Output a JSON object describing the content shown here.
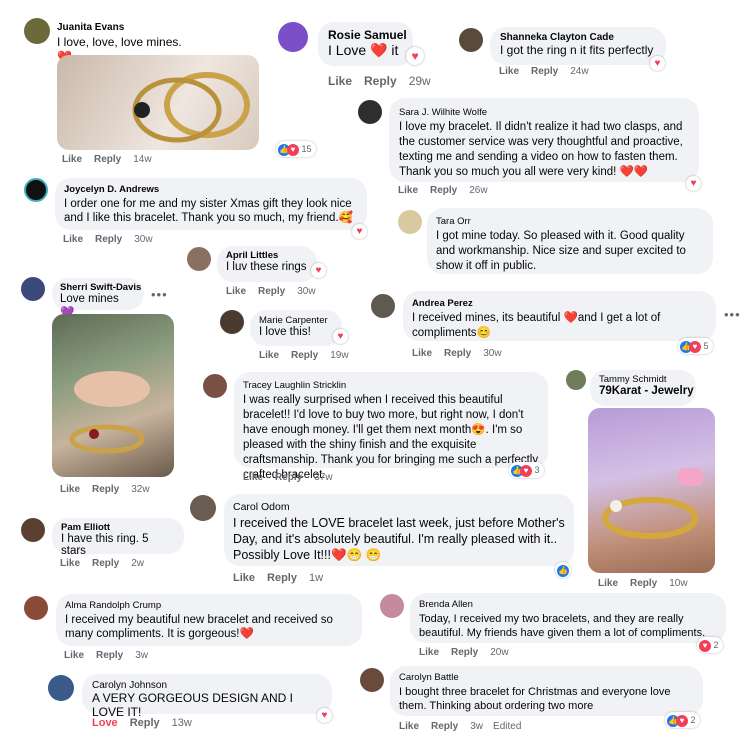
{
  "comments": [
    {
      "name": "Juanita Evans",
      "text": "I love, love, love mines.",
      "emoji": "❤️",
      "like": "Like",
      "reply": "Reply",
      "time": "14w",
      "reaction_count": "15"
    },
    {
      "name": "Rosie Samuel",
      "text_a": "I Love",
      "text_b": "it",
      "emoji": "❤️",
      "like": "Like",
      "reply": "Reply",
      "time": "29w"
    },
    {
      "name": "Shanneka Clayton Cade",
      "text": "I got the ring n it fits perfectly",
      "like": "Like",
      "reply": "Reply",
      "time": "24w"
    },
    {
      "name": "Sara J. Wilhite Wolfe",
      "text": "I love my bracelet. Il didn't realize it had two clasps, and the customer service was very thoughtful and proactive, texting me and sending a video on how to fasten them. Thank you so much you all were very kind!",
      "emoji": "❤️❤️",
      "like": "Like",
      "reply": "Reply",
      "time": "26w"
    },
    {
      "name": "Joycelyn D. Andrews",
      "text": "I order one for me and my sister Xmas gift they look nice and I like this bracelet. Thank you so much, my friend.",
      "emoji": "🥰",
      "like": "Like",
      "reply": "Reply",
      "time": "30w"
    },
    {
      "name": "Tara Orr",
      "text": "I got mine today. So pleased with it. Good quality and workmanship. Nice size and super excited to show it off in public."
    },
    {
      "name": "April Littles",
      "text": "I luv these rings",
      "like": "Like",
      "reply": "Reply",
      "time": "30w"
    },
    {
      "name": "Sherri Swift-Davis",
      "text": "Love mines",
      "emoji": "💜",
      "like": "Like",
      "reply": "Reply",
      "time": "32w"
    },
    {
      "name": "Andrea Perez",
      "text_a": "I received mines, its beautiful",
      "text_b": "and I get a lot of compliments",
      "emoji": "❤️",
      "emoji2": "😊",
      "like": "Like",
      "reply": "Reply",
      "time": "30w",
      "reaction_count": "5"
    },
    {
      "name": "Marie Carpenter",
      "text": "I love this!",
      "like": "Like",
      "reply": "Reply",
      "time": "19w"
    },
    {
      "name": "Tracey Laughlin Stricklin",
      "text": "I was really surprised when I received this beautiful bracelet!! I'd love to buy two more, but right now, I don't have enough money. I'll get them next month",
      "emoji": "😍",
      "text_b": ". I'm so pleased with the shiny finish and the exquisite craftsmanship. Thank you for bringing me such a perfectly crafted bracelet.",
      "like": "Like",
      "reply": "Reply",
      "time": "37w",
      "reaction_count": "3"
    },
    {
      "name": "Tammy Schmidt",
      "subtitle": "79Karat - Jewelry",
      "like": "Like",
      "reply": "Reply",
      "time": "10w"
    },
    {
      "name": "Carol Odom",
      "text": "I received the LOVE bracelet last week, just before Mother's Day, and it's absolutely beautiful. I'm really pleased with it.. Possibly Love It!!!",
      "emoji": "❤️😁 😁",
      "like": "Like",
      "reply": "Reply",
      "time": "1w"
    },
    {
      "name": "Pam Elliott",
      "text": "I have this ring. 5 stars",
      "like": "Like",
      "reply": "Reply",
      "time": "2w"
    },
    {
      "name": "Alma Randolph Crump",
      "text": "I received my beautiful new bracelet and received so many compliments. It is gorgeous!",
      "emoji": "❤️",
      "like": "Like",
      "reply": "Reply",
      "time": "3w"
    },
    {
      "name": "Brenda Allen",
      "text": "Today, I received my two bracelets, and they are really beautiful. My friends have given them a lot of compliments.",
      "like": "Like",
      "reply": "Reply",
      "time": "20w",
      "reaction_count": "2"
    },
    {
      "name": "Carolyn Johnson",
      "text": "A VERY GORGEOUS DESIGN AND I LOVE IT!",
      "like": "Love",
      "reply": "Reply",
      "time": "13w"
    },
    {
      "name": "Carolyn Battle",
      "text": "I bought three bracelet for Christmas and everyone love them. Thinking about ordering two more",
      "like": "Like",
      "reply": "Reply",
      "time": "3w",
      "edited": "Edited",
      "reaction_count": "2"
    }
  ],
  "icons": {
    "heart": "heart-icon",
    "like": "like-icon",
    "more": "more-options-icon"
  },
  "colors": {
    "bubble": "#f0f2f5",
    "love": "#f33e58",
    "like": "#1877f2",
    "meta": "#65676b"
  }
}
